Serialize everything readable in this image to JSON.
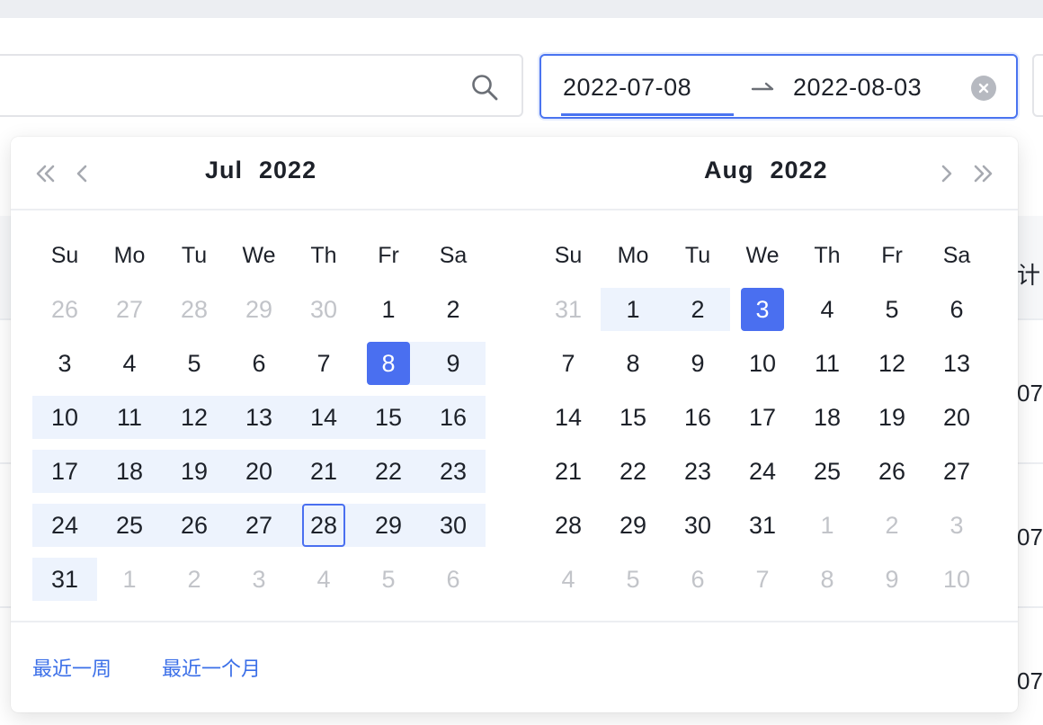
{
  "range": {
    "start": "2022-07-08",
    "end": "2022-08-03"
  },
  "background": {
    "header_fragment": "计",
    "row_fragments": [
      "07",
      "07",
      "07"
    ]
  },
  "calendar": {
    "left": {
      "month": "Jul",
      "year": "2022",
      "weekdays": [
        "Su",
        "Mo",
        "Tu",
        "We",
        "Th",
        "Fr",
        "Sa"
      ],
      "weeks": [
        [
          "26",
          "27",
          "28",
          "29",
          "30",
          "1",
          "2"
        ],
        [
          "3",
          "4",
          "5",
          "6",
          "7",
          "8",
          "9"
        ],
        [
          "10",
          "11",
          "12",
          "13",
          "14",
          "15",
          "16"
        ],
        [
          "17",
          "18",
          "19",
          "20",
          "21",
          "22",
          "23"
        ],
        [
          "24",
          "25",
          "26",
          "27",
          "28",
          "29",
          "30"
        ],
        [
          "31",
          "1",
          "2",
          "3",
          "4",
          "5",
          "6"
        ]
      ]
    },
    "right": {
      "month": "Aug",
      "year": "2022",
      "weekdays": [
        "Su",
        "Mo",
        "Tu",
        "We",
        "Th",
        "Fr",
        "Sa"
      ],
      "weeks": [
        [
          "31",
          "1",
          "2",
          "3",
          "4",
          "5",
          "6"
        ],
        [
          "7",
          "8",
          "9",
          "10",
          "11",
          "12",
          "13"
        ],
        [
          "14",
          "15",
          "16",
          "17",
          "18",
          "19",
          "20"
        ],
        [
          "21",
          "22",
          "23",
          "24",
          "25",
          "26",
          "27"
        ],
        [
          "28",
          "29",
          "30",
          "31",
          "1",
          "2",
          "3"
        ],
        [
          "4",
          "5",
          "6",
          "7",
          "8",
          "9",
          "10"
        ]
      ]
    }
  },
  "shortcuts": {
    "last_week": "最近一周",
    "last_month": "最近一个月"
  },
  "colors": {
    "accent": "#4a6ff0",
    "range_bg": "#edf3fd",
    "link": "#3b6fe8",
    "muted": "#c2c4c9"
  }
}
